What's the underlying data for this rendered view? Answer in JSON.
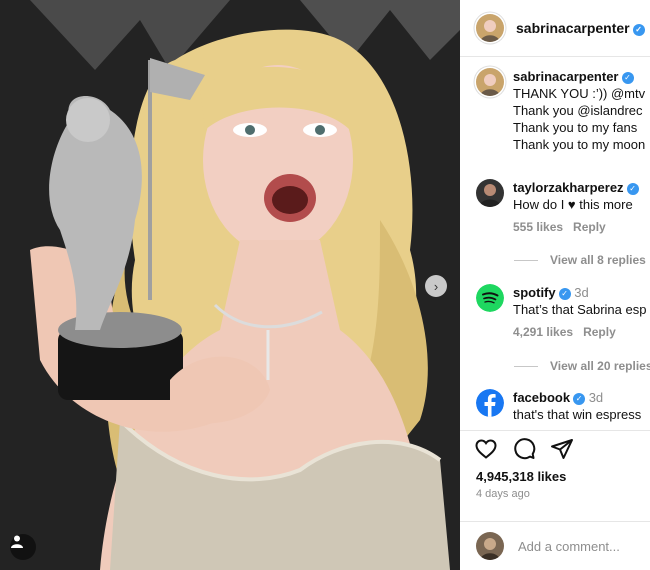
{
  "post": {
    "username": "sabrinacarpenter",
    "verified_mark": "✓"
  },
  "caption": {
    "username": "sabrinacarpenter",
    "lines": [
      "THANK YOU :’)) @mtv",
      "Thank you @islandrec",
      "Thank you to my fans",
      "Thank you to my moon"
    ]
  },
  "comments": [
    {
      "username": "taylorzakharperez",
      "text": "How do I ♥ this more",
      "likes": "555 likes",
      "reply": "Reply",
      "view_replies": "View all 8 replies"
    },
    {
      "username": "spotify",
      "time": "3d",
      "text": "That’s that Sabrina esp",
      "likes": "4,291 likes",
      "reply": "Reply",
      "view_replies": "View all 20 replies"
    },
    {
      "username": "facebook",
      "time": "3d",
      "text": "that's that win espress"
    }
  ],
  "footer": {
    "likes": "4,945,318 likes",
    "date": "4 days ago",
    "comment_placeholder": "Add a comment..."
  },
  "icons": {
    "like": "heart-icon",
    "comment": "comment-icon",
    "share": "share-icon",
    "next": "chevron-right-icon",
    "tags": "user-tag-icon"
  },
  "colors": {
    "verified": "#3897f0",
    "spotify": "#1ed760",
    "facebook": "#1877f2"
  }
}
